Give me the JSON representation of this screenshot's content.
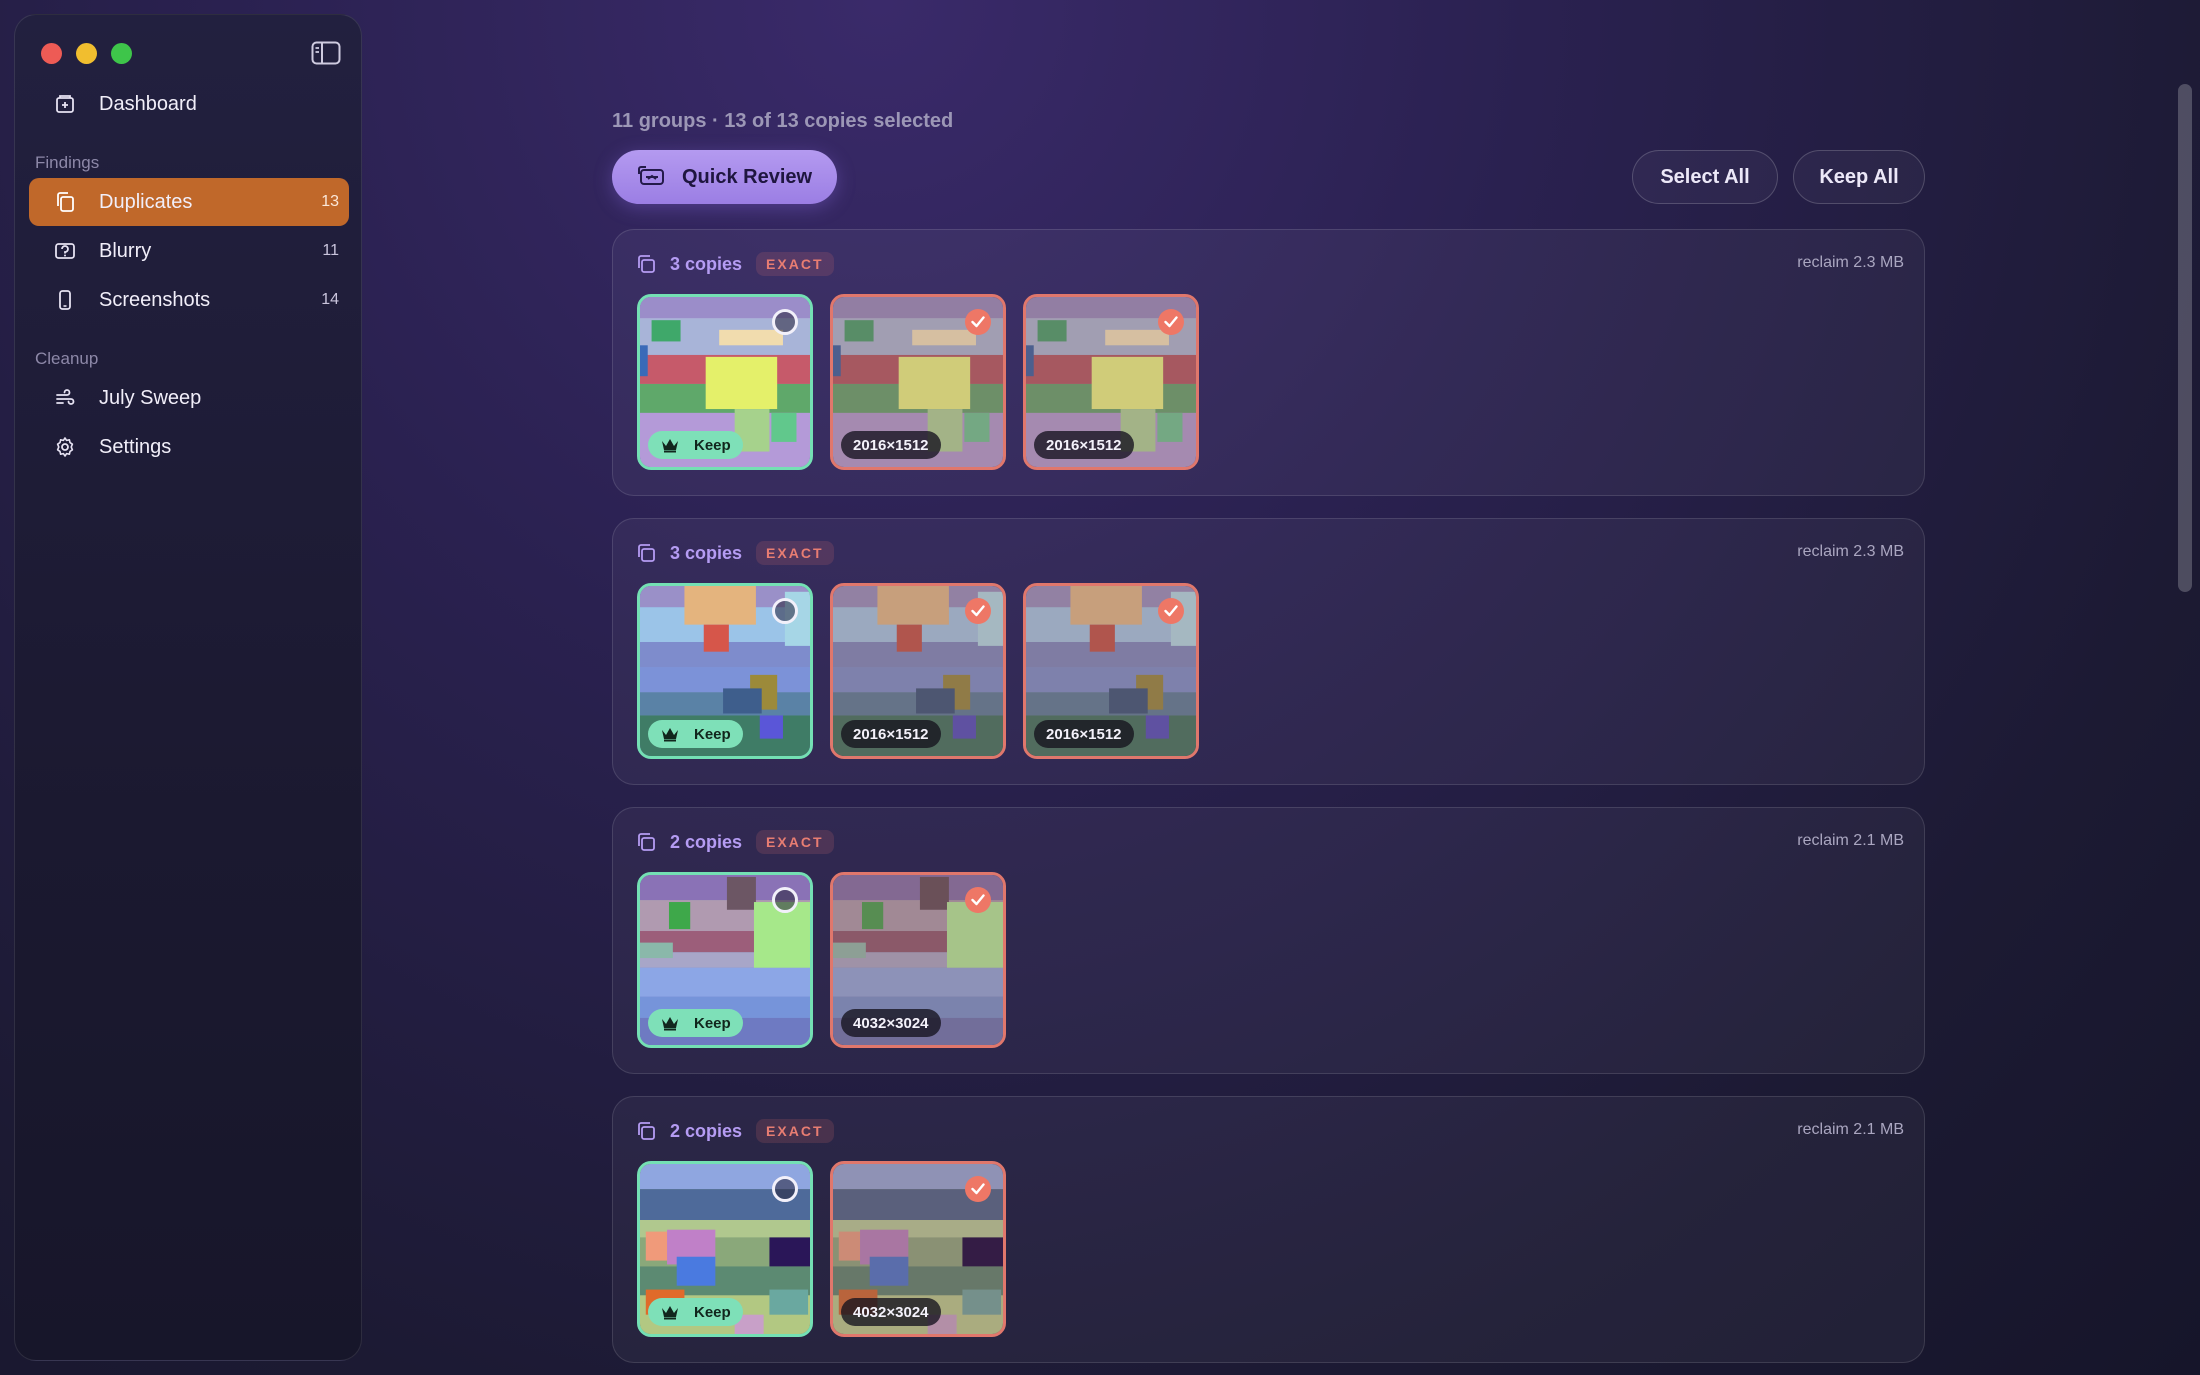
{
  "sidebar": {
    "items": [
      {
        "label": "Dashboard",
        "icon": "dashboard-icon"
      },
      {
        "label": "Duplicates",
        "count": "13",
        "icon": "duplicates-icon"
      },
      {
        "label": "Blurry",
        "count": "11",
        "icon": "blurry-icon"
      },
      {
        "label": "Screenshots",
        "count": "14",
        "icon": "phone-icon"
      },
      {
        "label": "July Sweep",
        "icon": "sweep-icon"
      },
      {
        "label": "Settings",
        "icon": "gear-icon"
      }
    ],
    "sections": {
      "findings": "Findings",
      "cleanup": "Cleanup"
    },
    "active_item": "Duplicates",
    "accent": "#c0682a"
  },
  "main": {
    "summary": "11 groups · 13 of 13 copies selected",
    "quick_review_label": "Quick Review",
    "select_all_label": "Select All",
    "keep_all_label": "Keep All",
    "keep_label": "Keep",
    "groups": [
      {
        "copies": "3 copies",
        "badge": "EXACT",
        "reclaim": "reclaim 2.3 MB",
        "dims": [
          "2016×1512",
          "2016×1512"
        ]
      },
      {
        "copies": "3 copies",
        "badge": "EXACT",
        "reclaim": "reclaim 2.3 MB",
        "dims": [
          "2016×1512",
          "2016×1512"
        ]
      },
      {
        "copies": "2 copies",
        "badge": "EXACT",
        "reclaim": "reclaim 2.1 MB",
        "dims": [
          "4032×3024"
        ]
      },
      {
        "copies": "2 copies",
        "badge": "EXACT",
        "reclaim": "reclaim 2.1 MB",
        "dims": [
          "4032×3024"
        ]
      }
    ]
  },
  "colors": {
    "keep_border": "#74e0b4",
    "duplicate_border": "#e0776c",
    "quick_review": "#a98cee"
  }
}
